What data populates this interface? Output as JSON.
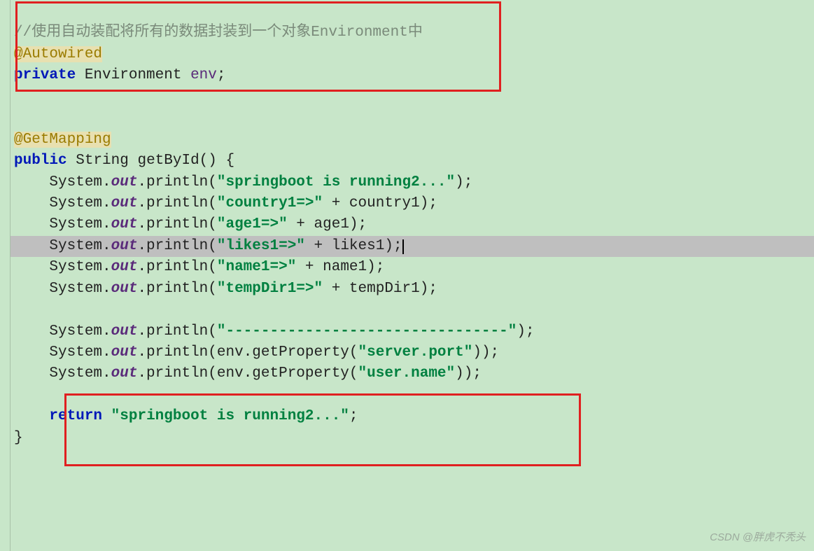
{
  "code": {
    "line1_comment": "//使用自动装配将所有的数据封装到一个对象Environment中",
    "line2_annotation": "@Autowired",
    "line3_keyword": "private",
    "line3_type": "Environment",
    "line3_var": "env",
    "line3_semi": ";",
    "line5_annotation": "@GetMapping",
    "line6_keyword": "public",
    "line6_type": "String",
    "line6_method": "getById() {",
    "sys": "System.",
    "out": "out",
    "println": ".println(",
    "close": ");",
    "s_running": "\"springboot is running2...\"",
    "s_country": "\"country1=>\"",
    "v_country": "country1",
    "s_age": "\"age1=>\"",
    "v_age": "age1",
    "s_likes": "\"likes1=>\"",
    "v_likes": "likes1",
    "s_name": "\"name1=>\"",
    "v_name": "name1",
    "s_temp": "\"tempDir1=>\"",
    "v_temp": "tempDir1",
    "s_dashes": "\"--------------------------------\"",
    "env_var": "env",
    "getprop": ".getProperty(",
    "s_serverport": "\"server.port\"",
    "s_username": "\"user.name\"",
    "closeparen": ")",
    "return_kw": "return",
    "return_str": "\"springboot is running2...\"",
    "return_semi": ";",
    "brace_close": "}",
    "plus": " + "
  },
  "watermark": "CSDN @胖虎不秃头"
}
